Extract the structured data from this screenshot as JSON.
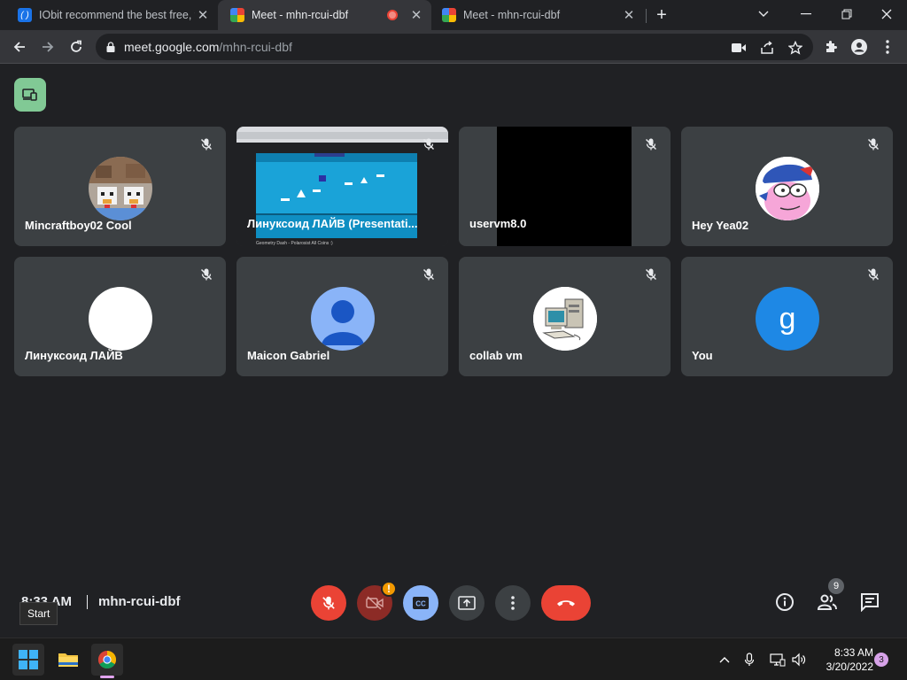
{
  "browser": {
    "tabs": [
      {
        "title": "IObit recommend the best free, f",
        "favicon": "iobit-icon",
        "active": false
      },
      {
        "title": "Meet - mhn-rcui-dbf",
        "favicon": "meet-icon",
        "active": true,
        "recording": true
      },
      {
        "title": "Meet - mhn-rcui-dbf",
        "favicon": "meet-icon",
        "active": false
      }
    ],
    "url_host": "meet.google.com",
    "url_path": "/mhn-rcui-dbf"
  },
  "meet": {
    "participants": [
      {
        "name": "Mincraftboy02 Cool",
        "muted": true,
        "avatar": "minecraft"
      },
      {
        "name": "Линуксоид ЛАЙВ (Presentati...",
        "muted": true,
        "avatar": "screen-share",
        "share_caption": "Geometry Dash - Polarosist All Coins :)"
      },
      {
        "name": "uservm8.0",
        "muted": true,
        "avatar": "black-video"
      },
      {
        "name": "Hey Yea02",
        "muted": true,
        "avatar": "cartoon"
      },
      {
        "name": "Линуксоид ЛАЙВ",
        "muted": true,
        "avatar": "white"
      },
      {
        "name": "Maicon Gabriel",
        "muted": true,
        "avatar": "generic-person"
      },
      {
        "name": "collab vm",
        "muted": true,
        "avatar": "computer"
      },
      {
        "name": "You",
        "muted": true,
        "avatar": "letter",
        "letter": "g"
      }
    ],
    "time": "8:33 AM",
    "meeting_code": "mhn-rcui-dbf",
    "warning_badge": "!",
    "people_count": "9",
    "start_tooltip": "Start"
  },
  "taskbar": {
    "clock_time": "8:33 AM",
    "clock_date": "3/20/2022",
    "notification_count": "3"
  },
  "colors": {
    "background": "#202124",
    "tile": "#3c4043",
    "mic_off_red": "#ea4335",
    "cc_blue": "#8ab4f8",
    "present_green": "#81c995"
  }
}
